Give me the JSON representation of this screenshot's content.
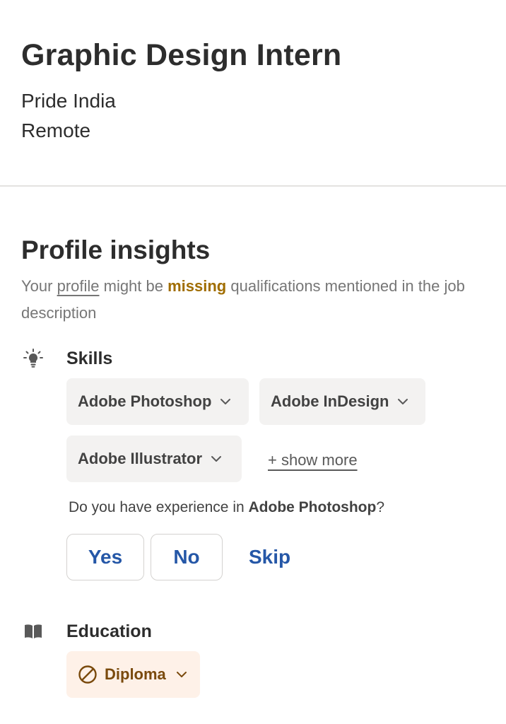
{
  "job": {
    "title": "Graphic Design Intern",
    "company": "Pride India",
    "location": "Remote"
  },
  "insights": {
    "heading": "Profile insights",
    "sub_prefix": "Your ",
    "sub_link": "profile",
    "sub_mid": " might be ",
    "sub_emphasis": "missing",
    "sub_suffix": " qualifications mentioned in the job description",
    "emphasis_color": "#a06d00"
  },
  "skills": {
    "icon": "lightbulb-icon",
    "title": "Skills",
    "chips": [
      "Adobe Photoshop",
      "Adobe InDesign",
      "Adobe Illustrator"
    ],
    "show_more": "+ show more",
    "question_prefix": "Do you have experience in ",
    "question_skill": "Adobe Photoshop",
    "question_suffix": "?",
    "answers": {
      "yes": "Yes",
      "no": "No",
      "skip": "Skip"
    },
    "accent_color": "#2557a7"
  },
  "education": {
    "icon": "book-icon",
    "title": "Education",
    "chip": "Diploma",
    "chip_icon": "ban-icon",
    "chip_bg": "#fef1e8"
  }
}
